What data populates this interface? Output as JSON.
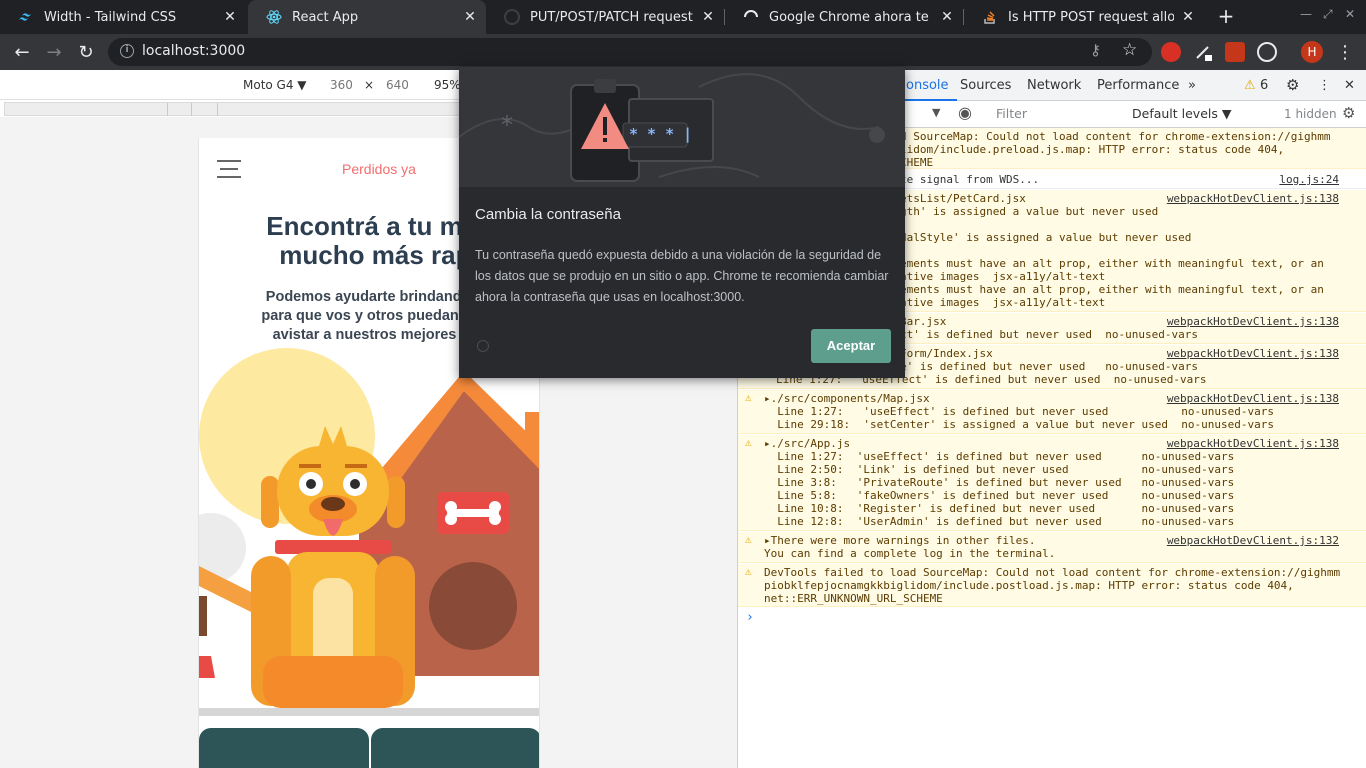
{
  "browser": {
    "tabs": [
      {
        "title": "Width - Tailwind CSS",
        "active": false
      },
      {
        "title": "React App",
        "active": true
      },
      {
        "title": "PUT/POST/PATCH request bo",
        "active": false
      },
      {
        "title": "Google Chrome ahora te avis",
        "active": false
      },
      {
        "title": "Is HTTP POST request allowe",
        "active": false
      }
    ],
    "url": "localhost:3000",
    "avatar_letter": "H"
  },
  "device_toolbar": {
    "device": "Moto G4 ▼",
    "width": "360",
    "times": "×",
    "height": "640",
    "zoom": "95%"
  },
  "app": {
    "brand": "Perdidos ya",
    "hero_title_1": "Encontrá a tu mas",
    "hero_title_2": "mucho más rapi",
    "hero_sub_1": "Podemos ayudarte brindando un",
    "hero_sub_2": "para que vos y otros puedan enco",
    "hero_sub_3": "avistar a nuestros mejores ami"
  },
  "dialog": {
    "title": "Cambia la contraseña",
    "body": "Tu contraseña quedó expuesta debido a una violación de la seguridad de los datos que se produjo en un sitio o app. Chrome te recomienda cambiar ahora la contraseña que usas en localhost:3000.",
    "password_mask": "* * * |",
    "accept_label": "Aceptar"
  },
  "devtools": {
    "tabs": [
      "onsole",
      "Sources",
      "Network",
      "Performance"
    ],
    "more": "»",
    "warning_count": "6",
    "filter_placeholder": "Filter",
    "levels": "Default levels ▼",
    "hidden": "1 hidden",
    "messages": [
      {
        "type": "warn",
        "lines": [
          "d SourceMap: Could not load content for chrome-extension://gighmm",
          "lidom/include.preload.js.map: HTTP error: status code 404,",
          "CHEME"
        ],
        "source": ""
      },
      {
        "type": "info",
        "lines": [
          "te signal from WDS..."
        ],
        "source": "log.js:24"
      },
      {
        "type": "warn",
        "lines": [
          "etsList/PetCard.jsx",
          "gth' is assigned a value but never used",
          "",
          "dalStyle' is assigned a value but never used",
          "",
          "ements must have an alt prop, either with meaningful text, or an",
          "ative images  jsx-a11y/alt-text",
          "ements must have an alt prop, either with meaningful text, or an",
          "ative images  jsx-a11y/alt-text"
        ],
        "source": "webpackHotDevClient.js:138"
      },
      {
        "type": "warn",
        "lines": [
          "Bar.jsx",
          "ct' is defined but never used  no-unused-vars"
        ],
        "source": "webpackHotDevClient.js:138"
      },
      {
        "type": "warn",
        "lines": [
          "Form/Index.jsx",
          "e' is defined but never used   no-unused-vars",
          "Line 1:27:  'useEffect' is defined but never used  no-unused-vars"
        ],
        "source": "webpackHotDevClient.js:138"
      },
      {
        "type": "warn",
        "lines": [
          "▸./src/components/Map.jsx",
          "  Line 1:27:   'useEffect' is defined but never used           no-unused-vars",
          "  Line 29:18:  'setCenter' is assigned a value but never used  no-unused-vars"
        ],
        "source": "webpackHotDevClient.js:138"
      },
      {
        "type": "warn",
        "lines": [
          "▸./src/App.js",
          "  Line 1:27:  'useEffect' is defined but never used      no-unused-vars",
          "  Line 2:50:  'Link' is defined but never used           no-unused-vars",
          "  Line 3:8:   'PrivateRoute' is defined but never used   no-unused-vars",
          "  Line 5:8:   'fakeOwners' is defined but never used     no-unused-vars",
          "  Line 10:8:  'Register' is defined but never used       no-unused-vars",
          "  Line 12:8:  'UserAdmin' is defined but never used      no-unused-vars"
        ],
        "source": "webpackHotDevClient.js:138"
      },
      {
        "type": "warn",
        "lines": [
          "▸There were more warnings in other files.",
          "You can find a complete log in the terminal."
        ],
        "source": "webpackHotDevClient.js:132"
      },
      {
        "type": "warn",
        "lines": [
          "DevTools failed to load SourceMap: Could not load content for chrome-extension://gighmm",
          "piobklfepjocnamgkkbiglidom/include.postload.js.map: HTTP error: status code 404,",
          "net::ERR_UNKNOWN_URL_SCHEME"
        ],
        "source": ""
      }
    ],
    "prompt": "›"
  },
  "colors": {
    "brand_accent": "#f36e6e",
    "dialog_button": "#5e9e8d",
    "warning_bg": "#fffbe5",
    "devtools_active": "#1a73e8"
  }
}
